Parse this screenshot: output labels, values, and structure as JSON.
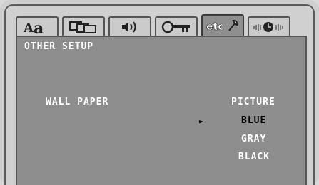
{
  "tabs": [
    {
      "icon": "aa-font-icon",
      "active": false
    },
    {
      "icon": "display-screens-icon",
      "active": false
    },
    {
      "icon": "speaker-icon",
      "active": false
    },
    {
      "icon": "key-icon",
      "active": false
    },
    {
      "icon": "etc-wrench-icon",
      "label": "etc",
      "active": true
    },
    {
      "icon": "clock-timer-icon",
      "active": false
    }
  ],
  "screen": {
    "title": "OTHER SETUP",
    "setting_label": "WALL PAPER",
    "options": [
      "PICTURE",
      "BLUE",
      "GRAY",
      "BLACK"
    ],
    "selected_option": "BLUE",
    "selection_marker": "►"
  },
  "colors": {
    "panel_bg": "#8d8d8d",
    "active_tab_bg": "#8f8f8f",
    "tab_bg": "#cbcbcb",
    "text": "#ffffff",
    "selected_text": "#000000"
  }
}
